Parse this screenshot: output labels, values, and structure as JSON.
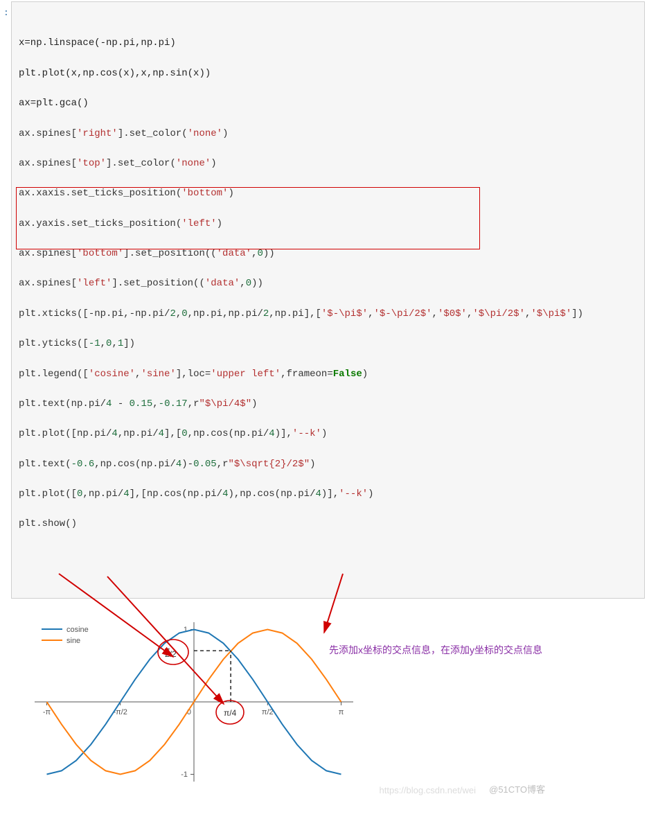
{
  "prompt": ":",
  "code": {
    "l1": "x=np.linspace(-np.pi,np.pi)",
    "l2": "plt.plot(x,np.cos(x),x,np.sin(x))",
    "l3": "ax=plt.gca()",
    "l4a": "ax.spines[",
    "l4s": "'right'",
    "l4b": "].set_color(",
    "l4c": "'none'",
    "l4d": ")",
    "l5a": "ax.spines[",
    "l5s": "'top'",
    "l5b": "].set_color(",
    "l5c": "'none'",
    "l5d": ")",
    "l6a": "ax.xaxis.set_ticks_position(",
    "l6s": "'bottom'",
    "l6b": ")",
    "l7a": "ax.yaxis.set_ticks_position(",
    "l7s": "'left'",
    "l7b": ")",
    "l8a": "ax.spines[",
    "l8s": "'bottom'",
    "l8b": "].set_position((",
    "l8c": "'data'",
    "l8d": ",",
    "l8n": "0",
    "l8e": "))",
    "l9a": "ax.spines[",
    "l9s": "'left'",
    "l9b": "].set_position((",
    "l9c": "'data'",
    "l9d": ",",
    "l9n": "0",
    "l9e": "))",
    "l10a": "plt.xticks([-np.pi,-np.pi/",
    "l10n1": "2",
    "l10b": ",",
    "l10n2": "0",
    "l10c": ",np.pi,np.pi/",
    "l10n3": "2",
    "l10d": ",np.pi],[",
    "l10s1": "'$-\\pi$'",
    "l10e1": ",",
    "l10s2": "'$-\\pi/2$'",
    "l10e2": ",",
    "l10s3": "'$0$'",
    "l10e3": ",",
    "l10s4": "'$\\pi/2$'",
    "l10e4": ",",
    "l10s5": "'$\\pi$'",
    "l10f": "])",
    "l11a": "plt.yticks([",
    "l11n1": "-1",
    "l11b": ",",
    "l11n2": "0",
    "l11c": ",",
    "l11n3": "1",
    "l11d": "])",
    "l12a": "plt.legend([",
    "l12s1": "'cosine'",
    "l12b": ",",
    "l12s2": "'sine'",
    "l12c": "],loc=",
    "l12s3": "'upper left'",
    "l12d": ",frameon=",
    "l12kw": "False",
    "l12e": ")",
    "l13a": "plt.text(np.pi/",
    "l13n1": "4",
    "l13b": " - ",
    "l13n2": "0.15",
    "l13c": ",",
    "l13n3": "-0.17",
    "l13d": ",r",
    "l13s": "\"$\\pi/4$\"",
    "l13e": ")",
    "l14a": "plt.plot([np.pi/",
    "l14n1": "4",
    "l14b": ",np.pi/",
    "l14n2": "4",
    "l14c": "],[",
    "l14n3": "0",
    "l14d": ",np.cos(np.pi/",
    "l14n4": "4",
    "l14e": ")],",
    "l14s": "'--k'",
    "l14f": ")",
    "l15a": "plt.text(",
    "l15n1": "-0.6",
    "l15b": ",np.cos(np.pi/",
    "l15n2": "4",
    "l15c": ")-",
    "l15n3": "0.05",
    "l15d": ",r",
    "l15s": "\"$\\sqrt{2}/2$\"",
    "l15e": ")",
    "l16a": "plt.plot([",
    "l16n1": "0",
    "l16b": ",np.pi/",
    "l16n2": "4",
    "l16c": "],[np.cos(np.pi/",
    "l16n3": "4",
    "l16d": "),np.cos(np.pi/",
    "l16n4": "4",
    "l16e": ")],",
    "l16s": "'--k'",
    "l16f": ")",
    "l17": "plt.show()"
  },
  "annotation_text": "先添加x坐标的交点信息，在添加y坐标的交点信息",
  "watermark1": "https://blog.csdn.net/wei",
  "watermark2": "@51CTO博客",
  "chart_data": {
    "type": "line",
    "title": "",
    "xlabel": "",
    "ylabel": "",
    "x": [
      -3.1416,
      -2.827,
      -2.513,
      -2.199,
      -1.885,
      -1.571,
      -1.257,
      -0.942,
      -0.628,
      -0.314,
      0,
      0.314,
      0.628,
      0.942,
      1.257,
      1.571,
      1.885,
      2.199,
      2.513,
      2.827,
      3.1416
    ],
    "series": [
      {
        "name": "cosine",
        "values": [
          -1,
          -0.951,
          -0.809,
          -0.588,
          -0.309,
          0,
          0.309,
          0.588,
          0.809,
          0.951,
          1,
          0.951,
          0.809,
          0.588,
          0.309,
          0,
          -0.309,
          -0.588,
          -0.809,
          -0.951,
          -1
        ]
      },
      {
        "name": "sine",
        "values": [
          0,
          -0.309,
          -0.588,
          -0.809,
          -0.951,
          -1,
          -0.951,
          -0.809,
          -0.588,
          -0.309,
          0,
          0.309,
          0.588,
          0.809,
          0.951,
          1,
          0.951,
          0.809,
          0.588,
          0.309,
          0
        ]
      }
    ],
    "xticks": {
      "positions": [
        -3.1416,
        -1.5708,
        0,
        3.1416,
        1.5708
      ],
      "labels": [
        "-π",
        "-π/2",
        "0",
        "π",
        "π/2"
      ]
    },
    "yticks": {
      "positions": [
        -1,
        0,
        1
      ],
      "labels": [
        "-1",
        "0",
        "1"
      ]
    },
    "xlim": [
      -3.4,
      3.4
    ],
    "ylim": [
      -1.1,
      1.1
    ],
    "legend": {
      "position": "upper left",
      "entries": [
        "cosine",
        "sine"
      ]
    },
    "annotations": [
      {
        "text": "π/4",
        "x": 0.635,
        "y": -0.17
      },
      {
        "text": "√2/2",
        "x": -0.6,
        "y": 0.657
      }
    ],
    "guide_lines": [
      {
        "x": [
          0.785,
          0.785
        ],
        "y": [
          0,
          0.707
        ],
        "style": "dashed",
        "color": "#000"
      },
      {
        "x": [
          0,
          0.785
        ],
        "y": [
          0.707,
          0.707
        ],
        "style": "dashed",
        "color": "#000"
      }
    ]
  },
  "colors": {
    "cos": "#1f77b4",
    "sin": "#ff7f0e",
    "axis": "#555",
    "arrow": "#d00000",
    "annot": "#8a2fa6"
  }
}
